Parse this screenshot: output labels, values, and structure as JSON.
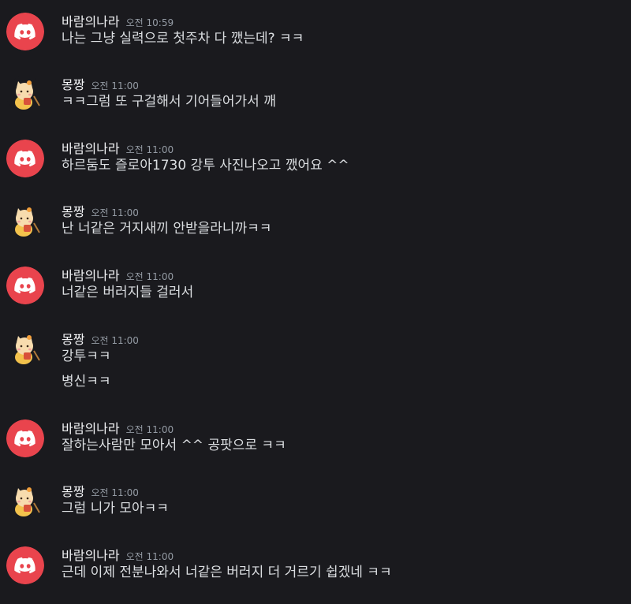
{
  "users": {
    "baram": {
      "name": "바람의나라",
      "avatar_icon": "discord-logo-icon",
      "avatar_color": "#e9444d"
    },
    "mong": {
      "name": "몽짱",
      "avatar_icon": "cat-mascot-icon",
      "avatar_color": "#1a1a1e"
    }
  },
  "messages": [
    {
      "author": "바람의나라",
      "time": "오전 10:59",
      "lines": [
        "나는 그냥 실력으로 첫주차 다 깼는데? ㅋㅋ"
      ]
    },
    {
      "author": "몽짱",
      "time": "오전 11:00",
      "lines": [
        "ㅋㅋ그럼 또 구걸해서 기어들어가서 깨"
      ]
    },
    {
      "author": "바람의나라",
      "time": "오전 11:00",
      "lines": [
        "하르둠도 즐로아1730 강투 사진나오고 깼어요 ^^"
      ]
    },
    {
      "author": "몽짱",
      "time": "오전 11:00",
      "lines": [
        "난 너같은 거지새끼 안받을라니까ㅋㅋ"
      ]
    },
    {
      "author": "바람의나라",
      "time": "오전 11:00",
      "lines": [
        "너같은 버러지들 걸러서"
      ]
    },
    {
      "author": "몽짱",
      "time": "오전 11:00",
      "lines": [
        "강투ㅋㅋ",
        "병신ㅋㅋ"
      ]
    },
    {
      "author": "바람의나라",
      "time": "오전 11:00",
      "lines": [
        "잘하는사람만 모아서 ^^ 공팟으로 ㅋㅋ"
      ]
    },
    {
      "author": "몽짱",
      "time": "오전 11:00",
      "lines": [
        "그럼 니가 모아ㅋㅋ"
      ]
    },
    {
      "author": "바람의나라",
      "time": "오전 11:00",
      "lines": [
        "근데 이제 전분나와서 너같은 버러지 더 거르기 쉽겠네 ㅋㅋ"
      ]
    }
  ]
}
